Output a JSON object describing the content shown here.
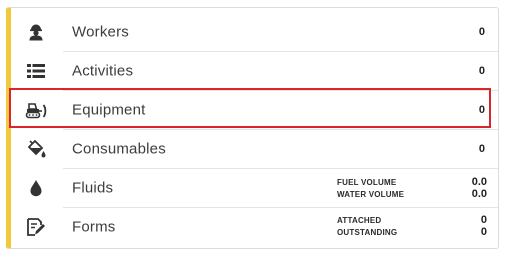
{
  "accent_color": "#f2c93a",
  "highlight_color": "#d9262b",
  "rows": [
    {
      "key": "workers",
      "icon": "worker-icon",
      "label": "Workers",
      "value": "0"
    },
    {
      "key": "activities",
      "icon": "list-icon",
      "label": "Activities",
      "value": "0"
    },
    {
      "key": "equipment",
      "icon": "bulldozer-icon",
      "label": "Equipment",
      "value": "0"
    },
    {
      "key": "consumables",
      "icon": "paint-bucket-icon",
      "label": "Consumables",
      "value": "0"
    },
    {
      "key": "fluids",
      "icon": "droplet-icon",
      "label": "Fluids",
      "details": [
        {
          "label": "FUEL VOLUME",
          "value": "0.0"
        },
        {
          "label": "WATER VOLUME",
          "value": "0.0"
        }
      ]
    },
    {
      "key": "forms",
      "icon": "form-edit-icon",
      "label": "Forms",
      "details": [
        {
          "label": "ATTACHED",
          "value": "0"
        },
        {
          "label": "OUTSTANDING",
          "value": "0"
        }
      ]
    }
  ]
}
